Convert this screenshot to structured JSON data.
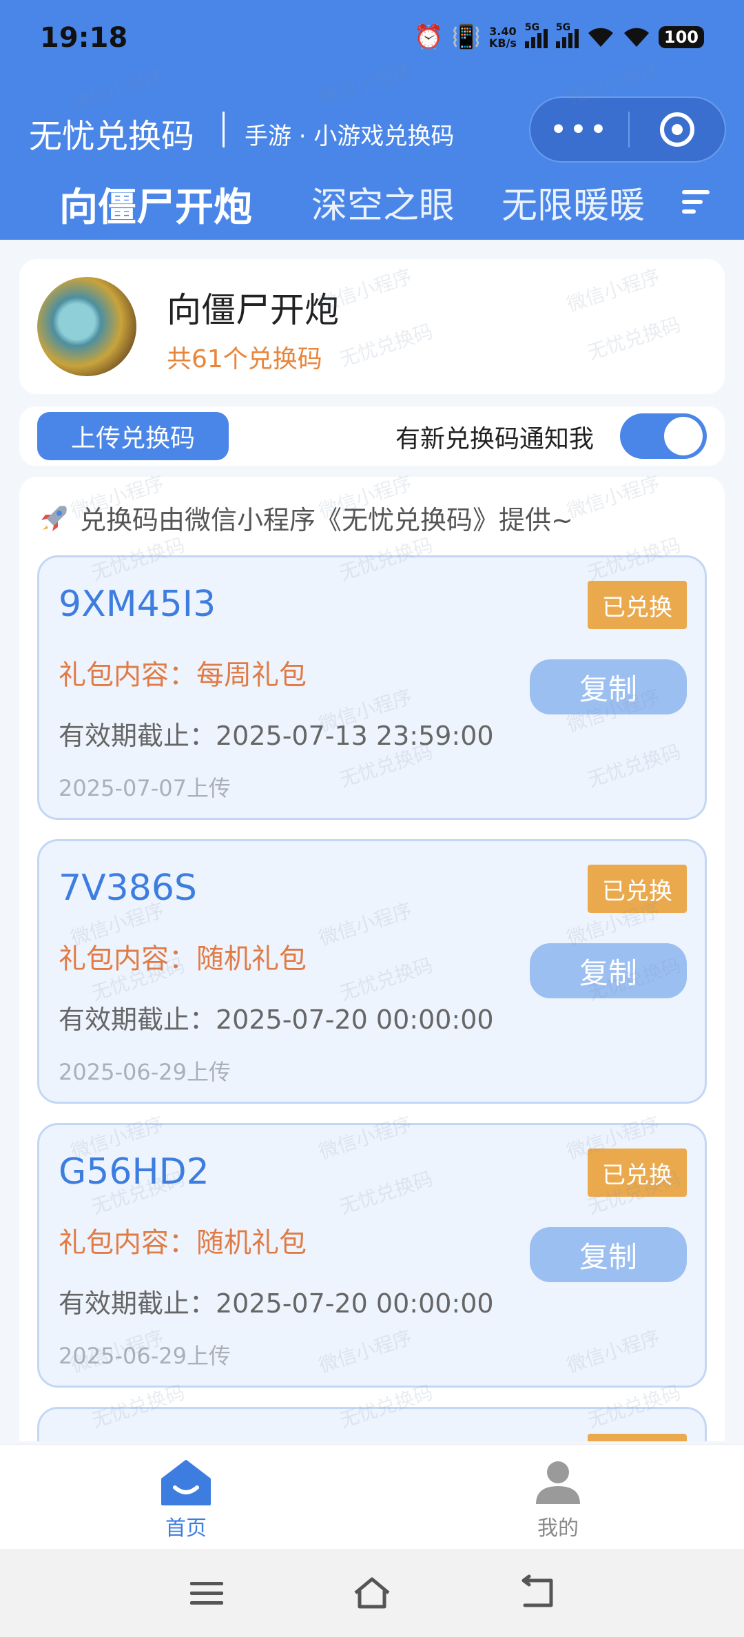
{
  "status_bar": {
    "time": "19:18",
    "net_speed_value": "3.40",
    "net_speed_unit": "KB/s",
    "sim1_label": "5G",
    "sim2_label": "5G",
    "battery": "100",
    "icons": [
      "alarm-icon",
      "vibrate-icon",
      "signal-icon",
      "signal-icon",
      "wifi-icon",
      "wifi-icon",
      "battery-icon"
    ]
  },
  "titlebar": {
    "app_name": "无忧兑换码",
    "subtitle": "手游 · 小游戏兑换码",
    "more_icon": "more-dots-icon",
    "close_icon": "target-close-icon"
  },
  "tabs": [
    {
      "label": "向僵尸开炮",
      "active": true
    },
    {
      "label": "深空之眼",
      "active": false
    },
    {
      "label": "无限暖暖",
      "active": false
    }
  ],
  "game": {
    "name": "向僵尸开炮",
    "count_text": "共61个兑换码"
  },
  "actions": {
    "upload_label": "上传兑换码",
    "notify_label": "有新兑换码通知我",
    "notify_on": true
  },
  "notice": "兑换码由微信小程序《无忧兑换码》提供~",
  "codes": [
    {
      "code": "9XM45I3",
      "status": "已兑换",
      "content": "礼包内容：每周礼包",
      "expiry": "有效期截止：2025-07-13 23:59:00",
      "uploaded": "2025-07-07上传",
      "copy": "复制"
    },
    {
      "code": "7V386S",
      "status": "已兑换",
      "content": "礼包内容：随机礼包",
      "expiry": "有效期截止：2025-07-20 00:00:00",
      "uploaded": "2025-06-29上传",
      "copy": "复制"
    },
    {
      "code": "G56HD2",
      "status": "已兑换",
      "content": "礼包内容：随机礼包",
      "expiry": "有效期截止：2025-07-20 00:00:00",
      "uploaded": "2025-06-29上传",
      "copy": "复制"
    }
  ],
  "watermark": [
    "微信小程序",
    "无忧兑换码"
  ],
  "bottom_nav": [
    {
      "label": "首页",
      "icon": "home-icon",
      "active": true
    },
    {
      "label": "我的",
      "icon": "profile-icon",
      "active": false
    }
  ],
  "colors": {
    "brand": "#4a86e8",
    "accent": "#e8853b",
    "badge": "#eaa94d"
  }
}
